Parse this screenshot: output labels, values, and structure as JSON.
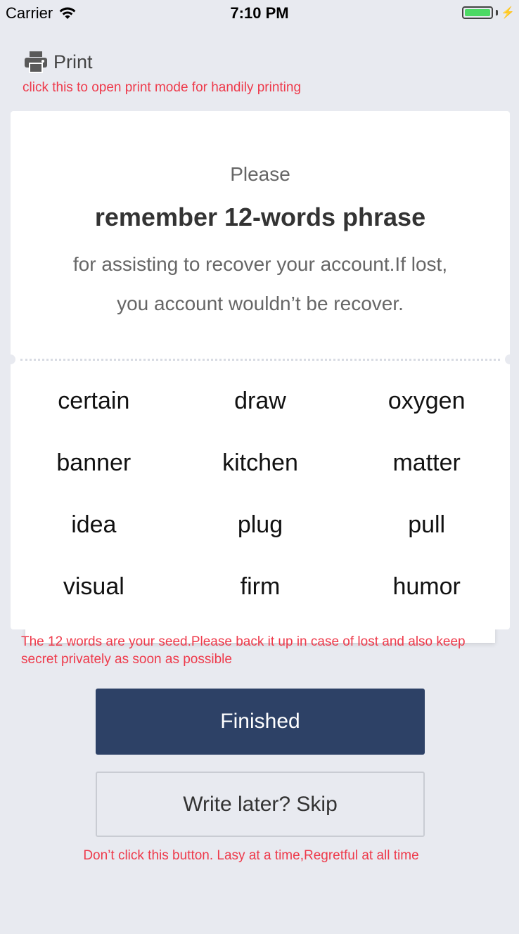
{
  "status_bar": {
    "carrier": "Carrier",
    "time": "7:10 PM",
    "wifi_icon": "wifi-icon",
    "battery_icon": "battery-icon",
    "charging_icon": "bolt-icon",
    "battery_level": 1.0
  },
  "print": {
    "icon": "printer-icon",
    "label": "Print",
    "hint": "click this to open print mode for handily printing"
  },
  "card": {
    "please": "Please",
    "title": "remember 12-words phrase",
    "description": "for assisting to recover your account.If lost, you account wouldn’t be recover."
  },
  "words": [
    "certain",
    "draw",
    "oxygen",
    "banner",
    "kitchen",
    "matter",
    "idea",
    "plug",
    "pull",
    "visual",
    "firm",
    "humor"
  ],
  "seed_note": "The 12 words are your seed.Please back it up in case of lost and also keep secret privately as soon as possible",
  "buttons": {
    "finished": "Finished",
    "skip": "Write later? Skip"
  },
  "skip_note": "Don’t click this button. Lasy at a time,Regretful at all time",
  "colors": {
    "background": "#e8eaf0",
    "primary": "#2d4166",
    "warning": "#ee3a4b",
    "battery": "#4cd964"
  }
}
